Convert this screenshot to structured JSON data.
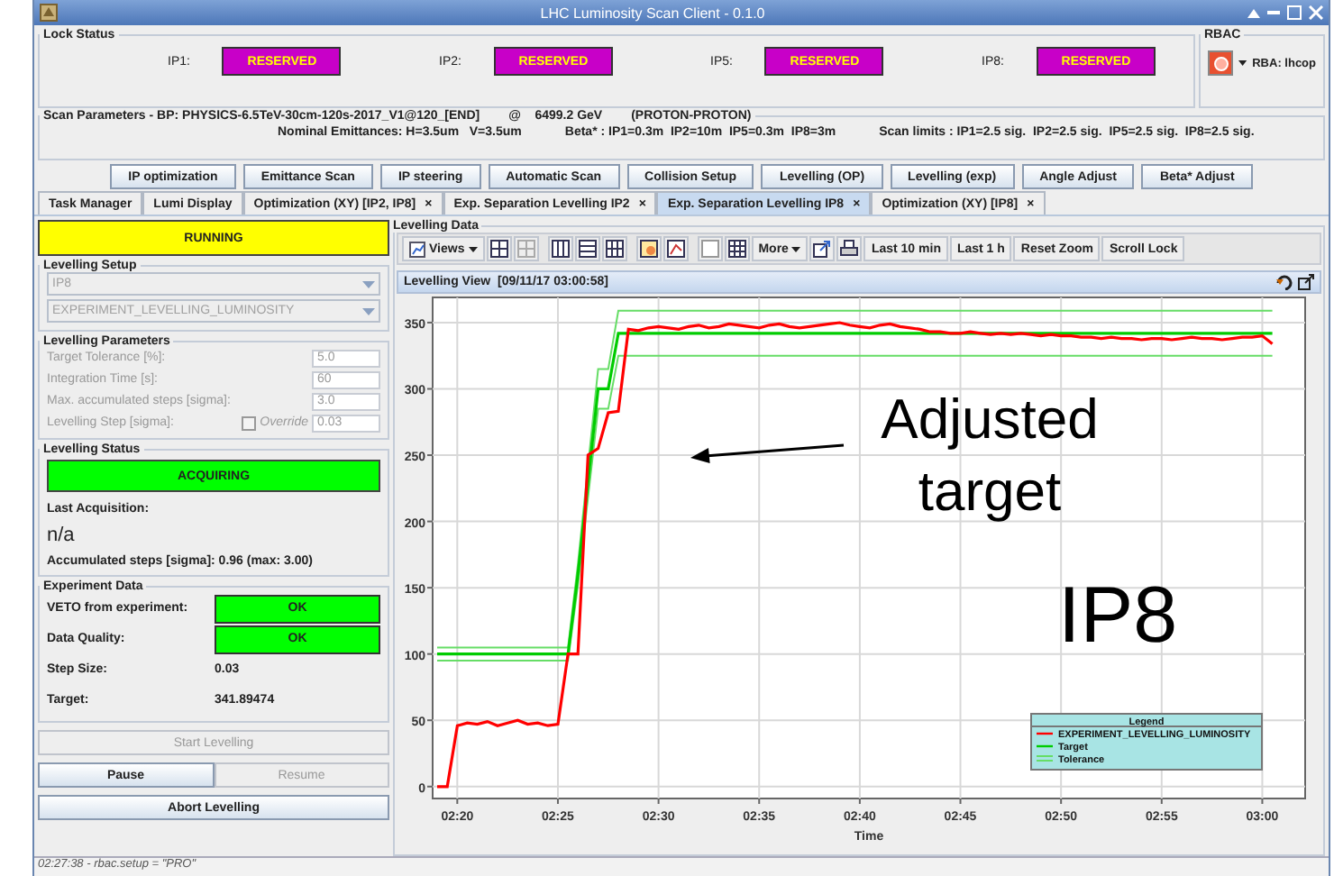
{
  "window": {
    "title": "LHC Luminosity Scan Client - 0.1.0"
  },
  "lock_status": {
    "title": "Lock Status",
    "locks": [
      {
        "label": "IP1:",
        "value": "RESERVED"
      },
      {
        "label": "IP2:",
        "value": "RESERVED"
      },
      {
        "label": "IP5:",
        "value": "RESERVED"
      },
      {
        "label": "IP8:",
        "value": "RESERVED"
      }
    ]
  },
  "rbac": {
    "title": "RBAC",
    "user": "RBA: lhcop"
  },
  "scan_parameters": {
    "title": "Scan Parameters - BP: PHYSICS-6.5TeV-30cm-120s-2017_V1@120_[END]",
    "energy": "@    6499.2 GeV",
    "particles": "(PROTON-PROTON)",
    "emittances": "Nominal Emittances: H=3.5um   V=3.5um",
    "beta": "Beta* : IP1=0.3m  IP2=10m  IP5=0.3m  IP8=3m",
    "limits": "Scan limits : IP1=2.5 sig.  IP2=2.5 sig.  IP5=2.5 sig.  IP8=2.5 sig."
  },
  "modes": [
    "IP optimization",
    "Emittance Scan",
    "IP steering",
    "Automatic Scan",
    "Collision Setup",
    "Levelling (OP)",
    "Levelling (exp)",
    "Angle Adjust",
    "Beta* Adjust"
  ],
  "tabs": [
    {
      "label": "Task Manager",
      "selected": false
    },
    {
      "label": "Lumi Display",
      "selected": false
    },
    {
      "label": "Optimization (XY) [IP2, IP8]",
      "close": "×",
      "selected": false
    },
    {
      "label": "Exp. Separation Levelling IP2",
      "close": "×",
      "selected": false
    },
    {
      "label": "Exp. Separation Levelling IP8",
      "close": "×",
      "selected": true
    },
    {
      "label": "Optimization (XY) [IP8]",
      "close": "×",
      "selected": false
    }
  ],
  "run_state": "RUNNING",
  "levelling_setup": {
    "title": "Levelling Setup",
    "disabled": true,
    "ip": "IP8",
    "mode": "EXPERIMENT_LEVELLING_LUMINOSITY"
  },
  "levelling_parameters": {
    "title": "Levelling Parameters",
    "disabled": true,
    "rows": [
      {
        "label": "Target Tolerance [%]:",
        "value": "5.0"
      },
      {
        "label": "Integration Time [s]:",
        "value": "60"
      },
      {
        "label": "Max. accumulated steps [sigma]:",
        "value": "3.0"
      },
      {
        "label": "Levelling Step [sigma]:",
        "value": "0.03",
        "override": {
          "label": "Override",
          "checked": false
        }
      }
    ]
  },
  "levelling_status": {
    "title": "Levelling Status",
    "state": "ACQUIRING",
    "last_label": "Last Acquisition:",
    "last_value": "n/a",
    "accumulated": "Accumulated steps [sigma]: 0.96 (max: 3.00)"
  },
  "experiment_data": {
    "title": "Experiment Data",
    "rows": [
      {
        "kind": "indicator",
        "label": "VETO from experiment:",
        "value": "OK"
      },
      {
        "kind": "indicator",
        "label": "Data Quality:",
        "value": "OK"
      },
      {
        "kind": "text",
        "label": "Step Size:",
        "value": "0.03"
      },
      {
        "kind": "text",
        "label": "Target:",
        "value": "341.89474"
      }
    ]
  },
  "controls": [
    {
      "label": "Start Levelling",
      "disabled": true
    },
    {
      "label": "Pause",
      "disabled": false
    },
    {
      "label": "Resume",
      "disabled": true
    },
    {
      "label": "Abort Levelling",
      "disabled": false
    }
  ],
  "levelling_data": {
    "title": "Levelling Data",
    "views": "Views",
    "more": "More",
    "range_buttons": [
      "Last 10 min",
      "Last 1 h",
      "Reset Zoom",
      "Scroll Lock"
    ],
    "view_title": "Levelling View  [09/11/17 03:00:58]",
    "legend_title": "Legend",
    "chart_data": {
      "type": "line",
      "xlabel": "Time",
      "ylim": [
        -9,
        369
      ],
      "grid": true,
      "legend": "lower right",
      "yticks": [
        0,
        50,
        100,
        150,
        200,
        250,
        300,
        350
      ],
      "categories": [
        null,
        null,
        "02:20",
        null,
        null,
        null,
        null,
        null,
        null,
        null,
        null,
        null,
        "02:25",
        null,
        null,
        null,
        null,
        null,
        null,
        null,
        null,
        null,
        "02:30",
        null,
        null,
        null,
        null,
        null,
        null,
        null,
        null,
        null,
        "02:35",
        null,
        null,
        null,
        null,
        null,
        null,
        null,
        null,
        null,
        "02:40",
        null,
        null,
        null,
        null,
        null,
        null,
        null,
        null,
        null,
        "02:45",
        null,
        null,
        null,
        null,
        null,
        null,
        null,
        null,
        null,
        "02:50",
        null,
        null,
        null,
        null,
        null,
        null,
        null,
        null,
        null,
        "02:55",
        null,
        null,
        null,
        null,
        null,
        null,
        null,
        null,
        null,
        "03:00",
        null
      ],
      "series": [
        {
          "name": "EXPERIMENT_LEVELLING_LUMINOSITY",
          "color": "#ff0000",
          "values": [
            0,
            0,
            46,
            48,
            47,
            49,
            46,
            48,
            50,
            47,
            48,
            46,
            47,
            100,
            100,
            250,
            255,
            282,
            283,
            345,
            344,
            346,
            347,
            346,
            345,
            347,
            348,
            346,
            347,
            349,
            348,
            347,
            346,
            348,
            349,
            347,
            346,
            347,
            348,
            349,
            350,
            348,
            347,
            346,
            348,
            349,
            347,
            346,
            345,
            343,
            343,
            342,
            342,
            343,
            342,
            341,
            342,
            341,
            342,
            341,
            340,
            341,
            340,
            340,
            339,
            339,
            338,
            339,
            338,
            338,
            337,
            338,
            338,
            337,
            338,
            339,
            338,
            338,
            337,
            338,
            339,
            339,
            340,
            334
          ]
        },
        {
          "name": "Target",
          "color": "#00cc00",
          "values": [
            100,
            100,
            100,
            100,
            100,
            100,
            100,
            100,
            100,
            100,
            100,
            100,
            100,
            100,
            160,
            230,
            300,
            300,
            342,
            342,
            342,
            342,
            342,
            342,
            342,
            342,
            342,
            342,
            342,
            342,
            342,
            342,
            342,
            342,
            342,
            342,
            342,
            342,
            342,
            342,
            342,
            342,
            342,
            342,
            342,
            342,
            342,
            342,
            342,
            342,
            342,
            342,
            342,
            342,
            342,
            342,
            342,
            342,
            342,
            342,
            342,
            342,
            342,
            342,
            342,
            342,
            342,
            342,
            342,
            342,
            342,
            342,
            342,
            342,
            342,
            342,
            342,
            342,
            342,
            342,
            342,
            342,
            342,
            342
          ]
        },
        {
          "name": "Tolerance",
          "color": "#66dd66",
          "values": [
            105,
            105,
            105,
            105,
            105,
            105,
            105,
            105,
            105,
            105,
            105,
            105,
            105,
            105,
            168,
            242,
            315,
            315,
            359,
            359,
            359,
            359,
            359,
            359,
            359,
            359,
            359,
            359,
            359,
            359,
            359,
            359,
            359,
            359,
            359,
            359,
            359,
            359,
            359,
            359,
            359,
            359,
            359,
            359,
            359,
            359,
            359,
            359,
            359,
            359,
            359,
            359,
            359,
            359,
            359,
            359,
            359,
            359,
            359,
            359,
            359,
            359,
            359,
            359,
            359,
            359,
            359,
            359,
            359,
            359,
            359,
            359,
            359,
            359,
            359,
            359,
            359,
            359,
            359,
            359,
            359,
            359,
            359,
            359
          ]
        },
        {
          "color": "#66dd66",
          "values": [
            95,
            95,
            95,
            95,
            95,
            95,
            95,
            95,
            95,
            95,
            95,
            95,
            95,
            95,
            152,
            218,
            285,
            285,
            325,
            325,
            325,
            325,
            325,
            325,
            325,
            325,
            325,
            325,
            325,
            325,
            325,
            325,
            325,
            325,
            325,
            325,
            325,
            325,
            325,
            325,
            325,
            325,
            325,
            325,
            325,
            325,
            325,
            325,
            325,
            325,
            325,
            325,
            325,
            325,
            325,
            325,
            325,
            325,
            325,
            325,
            325,
            325,
            325,
            325,
            325,
            325,
            325,
            325,
            325,
            325,
            325,
            325,
            325,
            325,
            325,
            325,
            325,
            325,
            325,
            325,
            325,
            325,
            325,
            325
          ]
        }
      ]
    }
  },
  "status_bar": "02:27:38 - rbac.setup = \"PRO\"",
  "overlay_notes": [
    {
      "kind": "arrow_label",
      "text": "Adjusted target"
    },
    {
      "kind": "label",
      "text": "IP8"
    }
  ]
}
